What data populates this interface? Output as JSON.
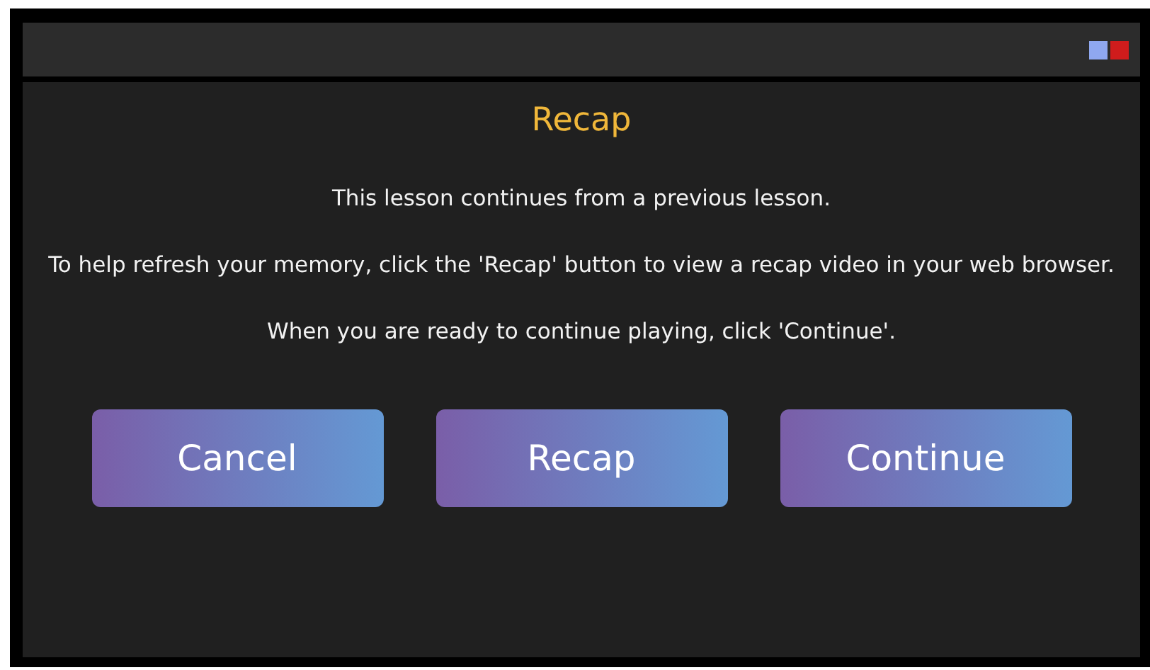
{
  "title_bar": {
    "controls": [
      {
        "color": "#8fa8f0"
      },
      {
        "color": "#d01c1c"
      }
    ]
  },
  "dialog": {
    "title": "Recap",
    "paragraphs": [
      "This lesson continues from a previous lesson.",
      "To help refresh your memory, click the 'Recap' button to view a recap video in your web browser.",
      "When you are ready to continue playing, click 'Continue'."
    ],
    "buttons": [
      "Cancel",
      "Recap",
      "Continue"
    ]
  }
}
